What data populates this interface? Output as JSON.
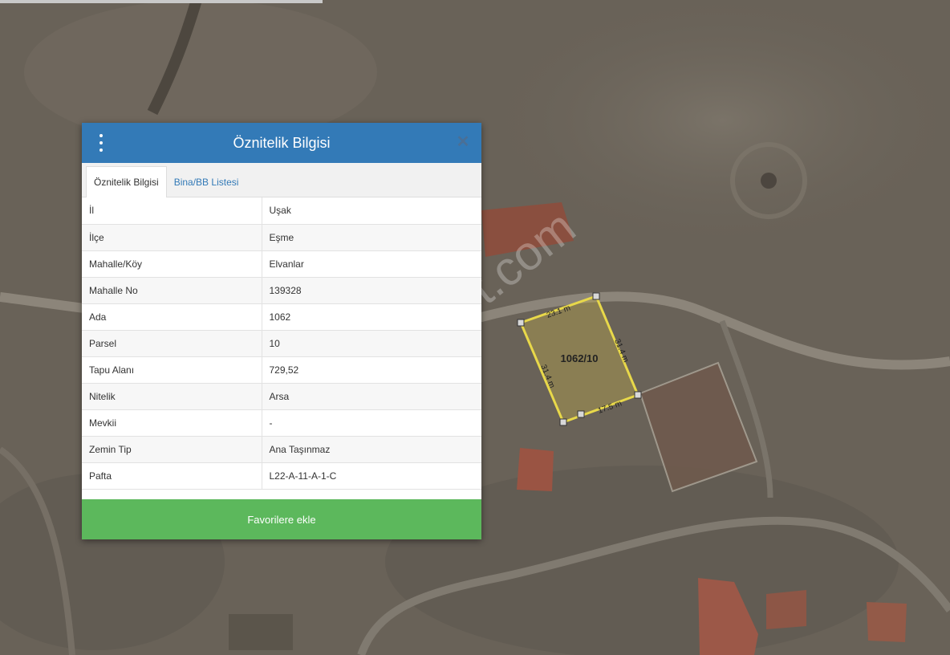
{
  "map": {
    "parcel_label": "1062/10",
    "edges": {
      "top": "23.1 m",
      "right": "31.4 m",
      "left": "31.4 m",
      "bottom": "17.5 m"
    },
    "watermark": "emlakjet.com",
    "colors": {
      "parcel_stroke": "#e8d84a",
      "parcel_fill": "#c8b44a"
    }
  },
  "dialog": {
    "title": "Öznitelik Bilgisi",
    "tabs": [
      {
        "label": "Öznitelik Bilgisi"
      },
      {
        "label": "Bina/BB Listesi"
      }
    ],
    "rows": [
      {
        "key": "İl",
        "value": "Uşak"
      },
      {
        "key": "İlçe",
        "value": "Eşme"
      },
      {
        "key": "Mahalle/Köy",
        "value": "Elvanlar"
      },
      {
        "key": "Mahalle No",
        "value": "139328"
      },
      {
        "key": "Ada",
        "value": "1062"
      },
      {
        "key": "Parsel",
        "value": "10"
      },
      {
        "key": "Tapu Alanı",
        "value": "729,52"
      },
      {
        "key": "Nitelik",
        "value": "Arsa"
      },
      {
        "key": "Mevkii",
        "value": "-"
      },
      {
        "key": "Zemin Tip",
        "value": "Ana Taşınmaz"
      },
      {
        "key": "Pafta",
        "value": "L22-A-11-A-1-C"
      }
    ],
    "favorite_button": "Favorilere ekle",
    "colors": {
      "header": "#337ab7",
      "button": "#5cb85c"
    }
  }
}
